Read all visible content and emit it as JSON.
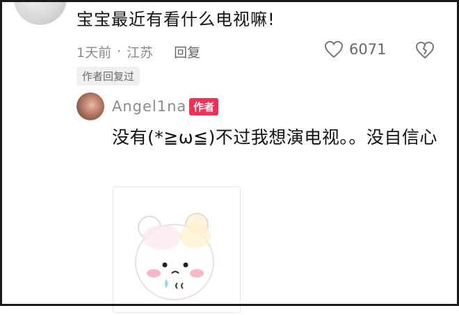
{
  "top_comment": {
    "text": "宝宝最近有看什么电视嘛!",
    "time": "1天前",
    "location": "江苏",
    "separator": "·",
    "reply_label": "回复",
    "like_count": "6071",
    "author_replied_badge": "作者回复过"
  },
  "reply": {
    "username": "Angel1na",
    "author_tag": "作者",
    "text": "没有(*≧ω≦)不过我想演电视。。没自信心"
  },
  "icons": {
    "like": "heart-icon",
    "dislike": "broken-heart-icon"
  },
  "colors": {
    "author_tag_bg": "#fe2c55",
    "meta_text": "#8a8a8a"
  }
}
